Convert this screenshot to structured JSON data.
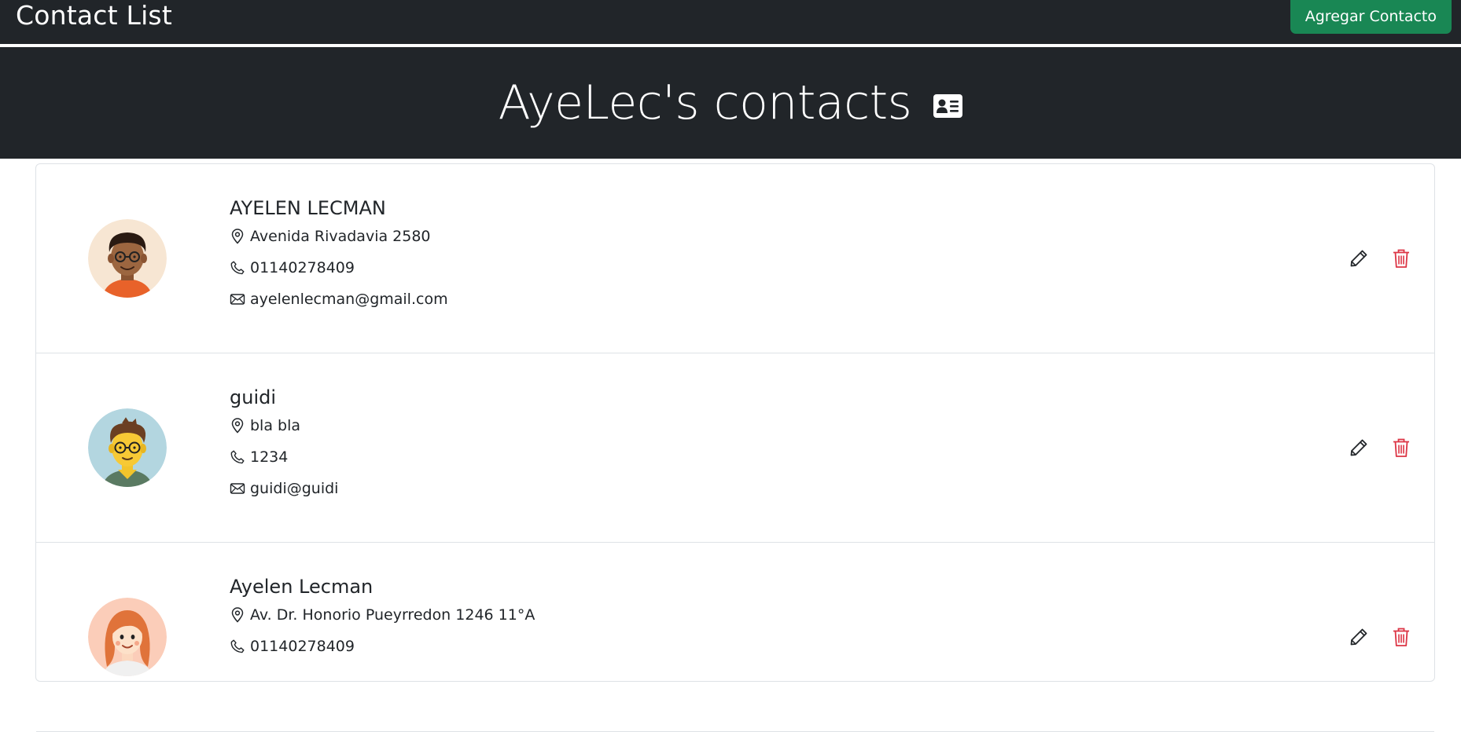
{
  "navbar": {
    "brand": "Contact List",
    "add_button_label": "Agregar Contacto"
  },
  "header": {
    "title": "AyeLec's contacts",
    "icon": "contact-card-icon"
  },
  "contacts": [
    {
      "name": "AYELEN LECMAN",
      "address": "Avenida Rivadavia 2580",
      "phone": "01140278409",
      "email": "ayelenlecman@gmail.com",
      "avatar_bg": "#f7e6d3"
    },
    {
      "name": "guidi",
      "address": "bla bla",
      "phone": "1234",
      "email": "guidi@guidi",
      "avatar_bg": "#b3d6e0"
    },
    {
      "name": "Ayelen Lecman",
      "address": "Av. Dr. Honorio Pueyrredon 1246 11°A",
      "phone": "01140278409",
      "avatar_bg": "#fbcdb9"
    }
  ],
  "colors": {
    "dark": "#212529",
    "success": "#198754",
    "danger": "#dc3545",
    "border": "#dee2e6"
  }
}
